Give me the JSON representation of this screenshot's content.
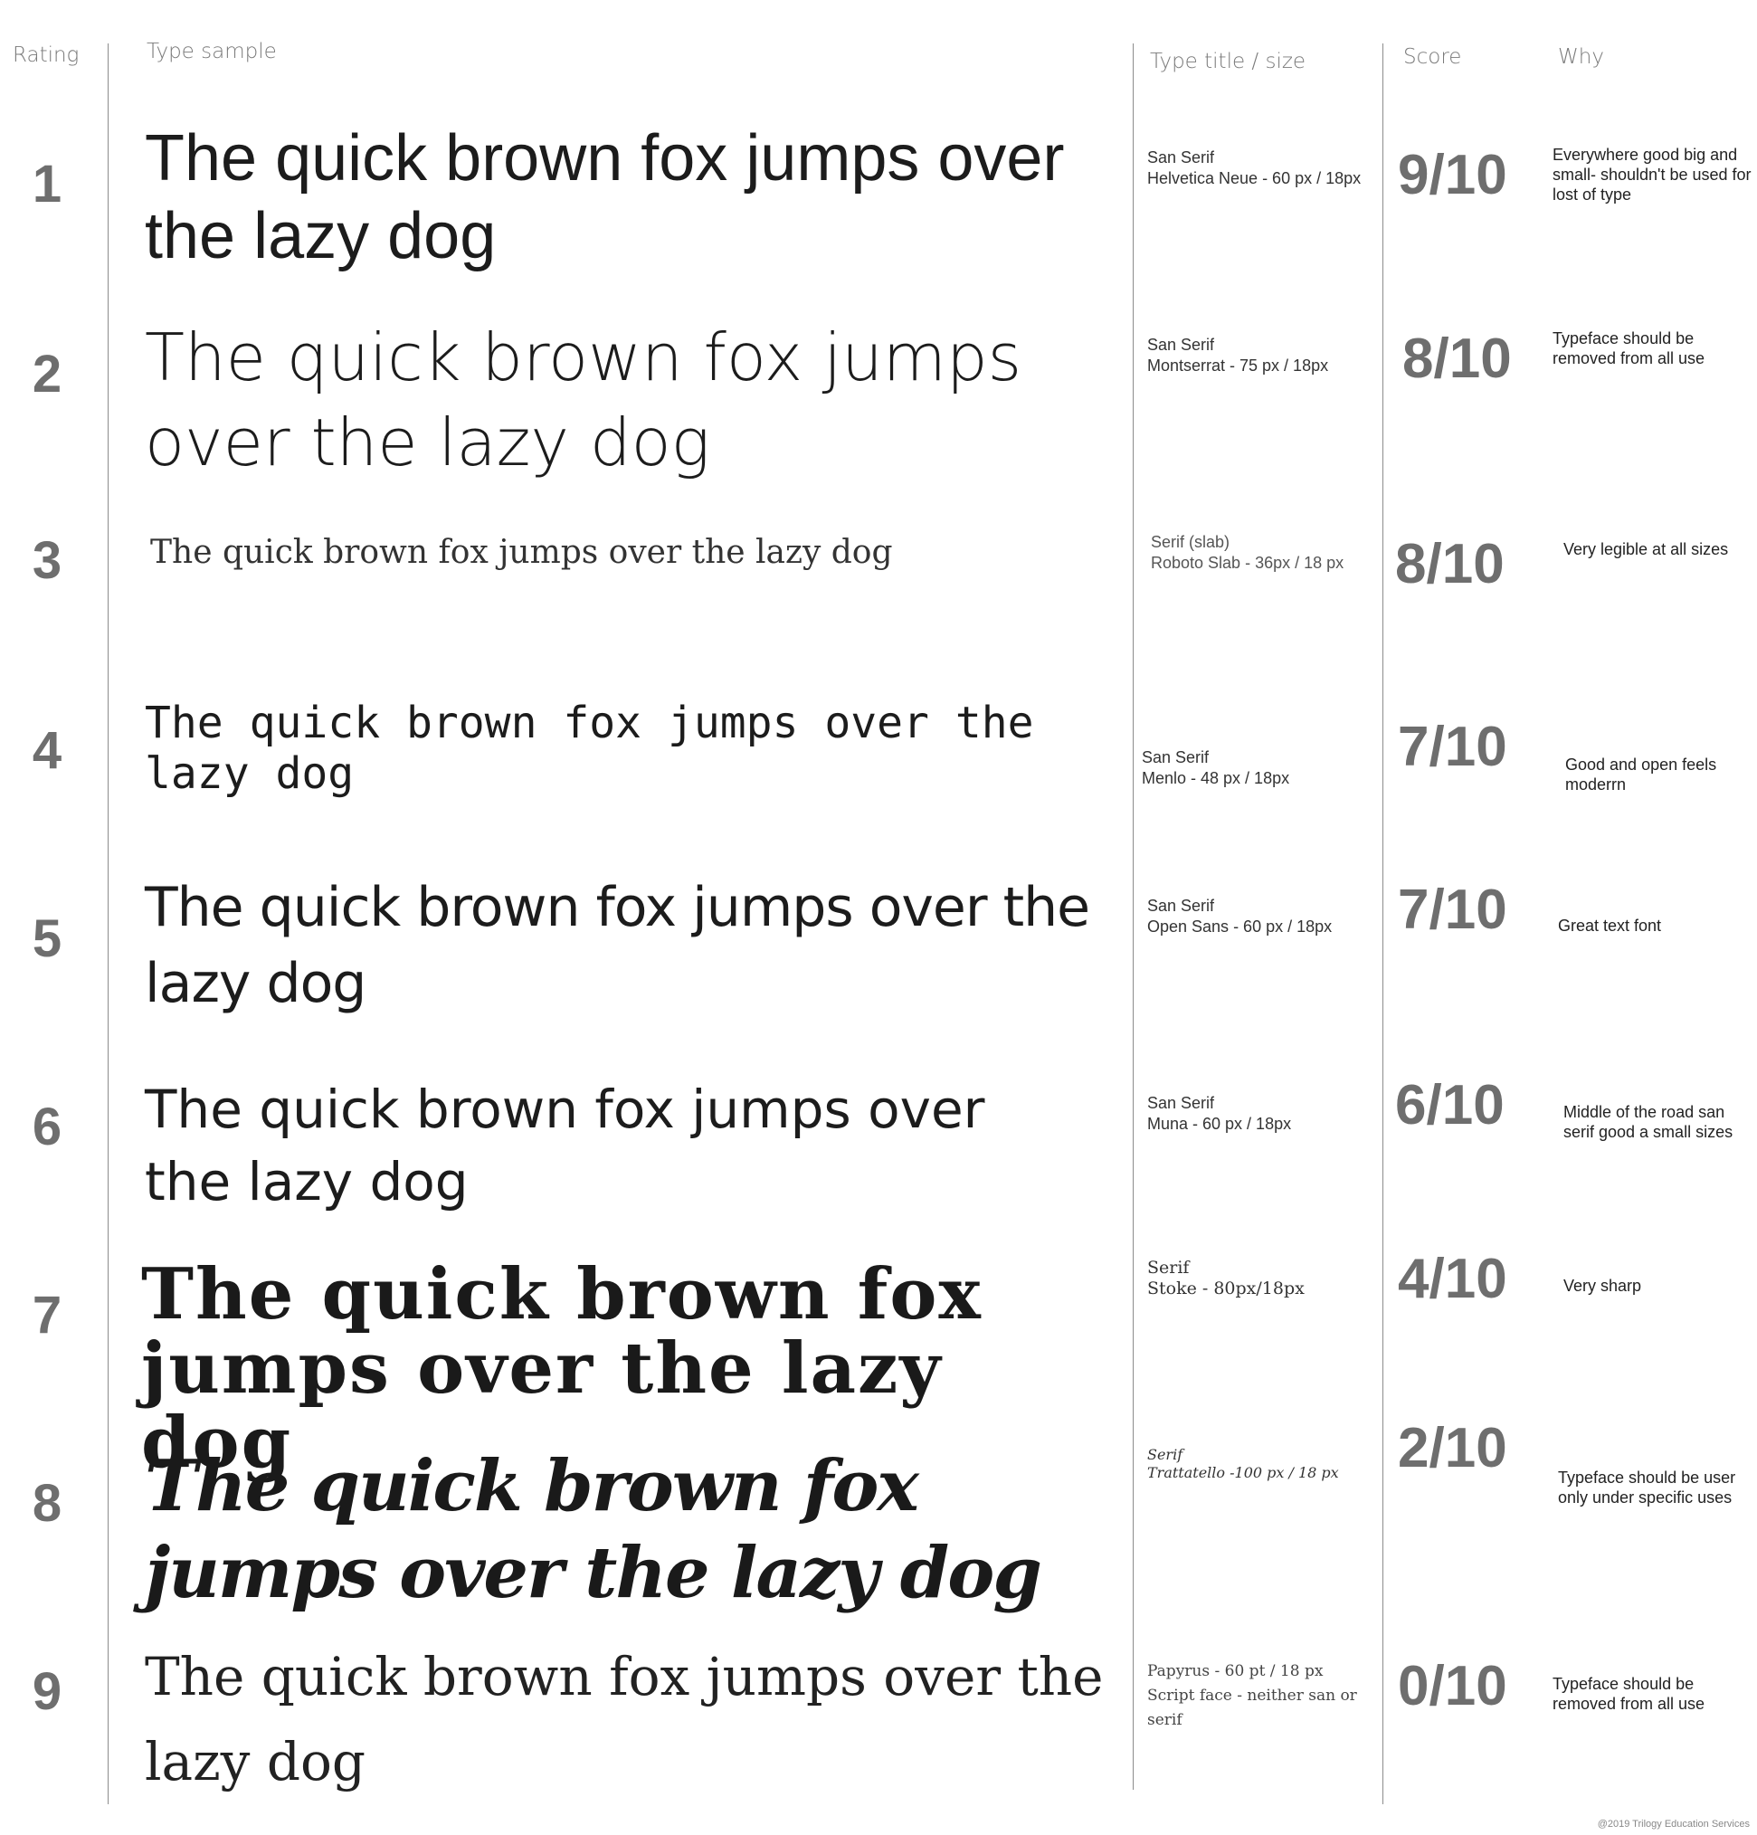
{
  "headers": {
    "rating": "Rating",
    "sample": "Type sample",
    "title": "Type title / size",
    "score": "Score",
    "why": "Why"
  },
  "rows": [
    {
      "rating": "1",
      "sample": "The quick brown fox jumps over the lazy dog",
      "title": "San Serif\nHelvetica Neue - 60 px / 18px",
      "score": "9/10",
      "why": "Everywhere good big and small- shouldn't be used for lost of type"
    },
    {
      "rating": "2",
      "sample": "The quick brown fox jumps over the lazy dog",
      "title": "San Serif\nMontserrat - 75 px / 18px",
      "score": "8/10",
      "why": "Typeface should be removed from all use"
    },
    {
      "rating": "3",
      "sample": "The quick brown fox jumps over the lazy dog",
      "title": "Serif (slab)\nRoboto Slab - 36px / 18 px",
      "score": "8/10",
      "why": "Very legible at all sizes"
    },
    {
      "rating": "4",
      "sample": "The quick brown fox jumps over the lazy dog",
      "title": "San Serif\nMenlo - 48 px / 18px",
      "score": "7/10",
      "why": "Good and open feels moderrn"
    },
    {
      "rating": "5",
      "sample": "The quick brown fox jumps over the lazy dog",
      "title": "San Serif\nOpen Sans - 60 px / 18px",
      "score": "7/10",
      "why": "Great text font"
    },
    {
      "rating": "6",
      "sample": "The quick brown fox jumps over the lazy dog",
      "title": "San Serif\nMuna - 60 px / 18px",
      "score": "6/10",
      "why": "Middle of the road san serif good a small sizes"
    },
    {
      "rating": "7",
      "sample": "The quick brown fox jumps over the lazy dog",
      "title": "Serif\nStoke - 80px/18px",
      "score": "4/10",
      "why": "Very sharp"
    },
    {
      "rating": "8",
      "sample": "The quick brown fox jumps over the lazy dog",
      "title": "Serif\nTrattatello -100 px / 18 px",
      "score": "2/10",
      "why": "Typeface should be user only under specific uses"
    },
    {
      "rating": "9",
      "sample": "The quick brown fox jumps over the lazy dog",
      "title": "Papyrus - 60 pt / 18 px\nScript face - neither san or serif",
      "score": "0/10",
      "why": "Typeface should be removed from all use"
    }
  ],
  "footer": "@2019 Trilogy Education Services"
}
